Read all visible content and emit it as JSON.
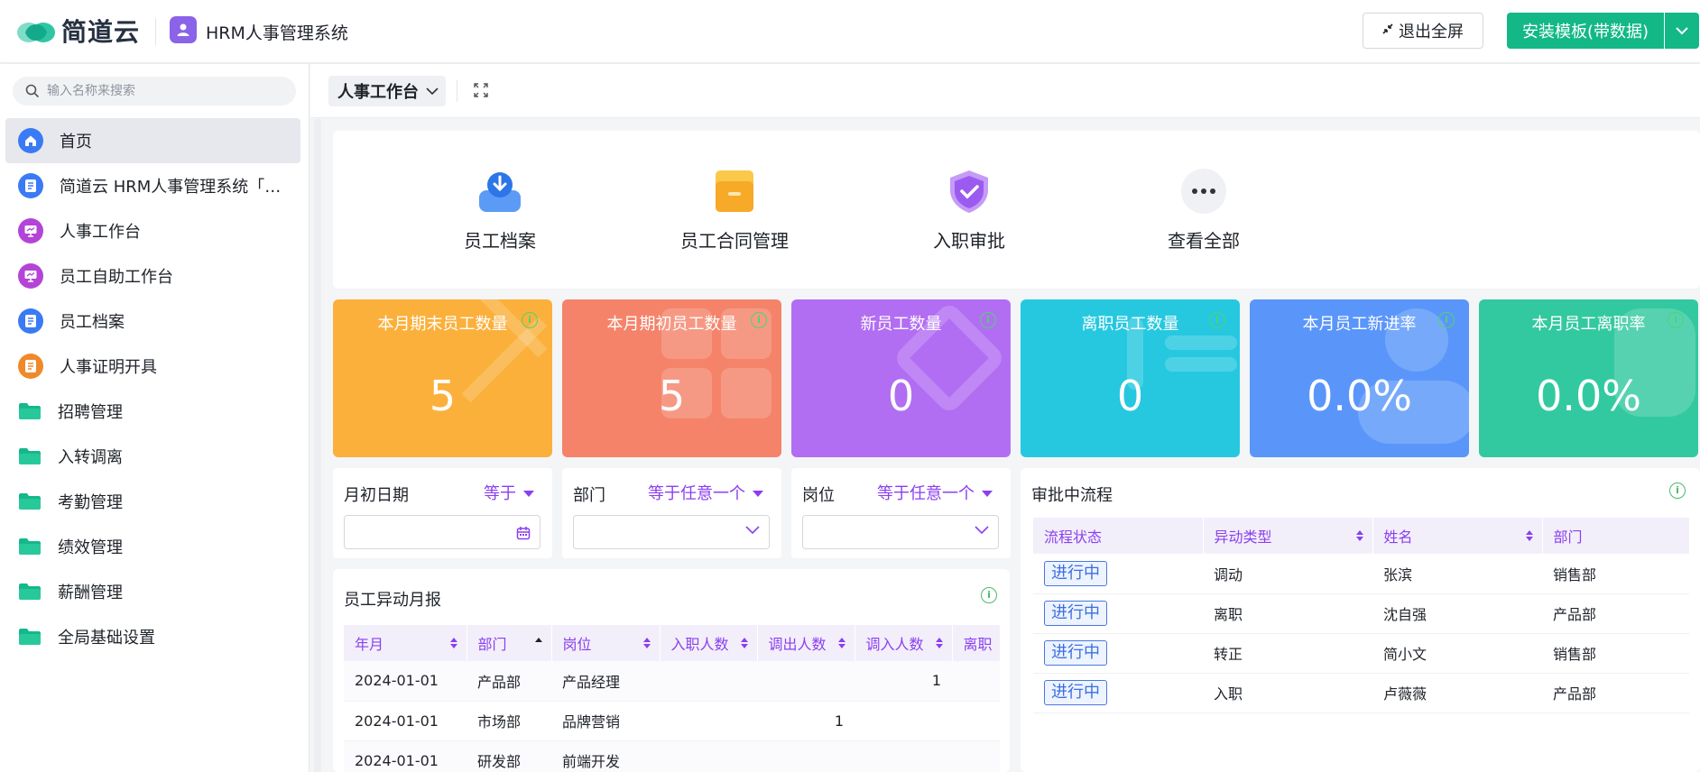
{
  "header": {
    "brand": "简道云",
    "app_title": "HRM人事管理系统",
    "exit_fullscreen": "退出全屏",
    "install_template": "安装模板(带数据)",
    "accent": "#13b886"
  },
  "sidebar": {
    "search_placeholder": "输入名称来搜索",
    "items": [
      {
        "label": "首页",
        "icon": "home-icon",
        "color": "#3a7bf5"
      },
      {
        "label": "简道云 HRM人事管理系统「必读」",
        "icon": "document-icon",
        "color": "#3a7bf5"
      },
      {
        "label": "人事工作台",
        "icon": "dashboard-icon",
        "color": "#b444d8"
      },
      {
        "label": "员工自助工作台",
        "icon": "dashboard-icon",
        "color": "#b444d8"
      },
      {
        "label": "员工档案",
        "icon": "document-icon",
        "color": "#3a7bf5"
      },
      {
        "label": "人事证明开具",
        "icon": "document-icon",
        "color": "#f0892a"
      },
      {
        "label": "招聘管理",
        "icon": "folder-icon",
        "color": "#14b88a"
      },
      {
        "label": "入转调离",
        "icon": "folder-icon",
        "color": "#14b88a"
      },
      {
        "label": "考勤管理",
        "icon": "folder-icon",
        "color": "#14b88a"
      },
      {
        "label": "绩效管理",
        "icon": "folder-icon",
        "color": "#14b88a"
      },
      {
        "label": "薪酬管理",
        "icon": "folder-icon",
        "color": "#14b88a"
      },
      {
        "label": "全局基础设置",
        "icon": "folder-icon",
        "color": "#14b88a"
      }
    ]
  },
  "tabbar": {
    "current": "人事工作台"
  },
  "quick_links": [
    {
      "label": "员工档案",
      "icon": "employee-file-icon"
    },
    {
      "label": "员工合同管理",
      "icon": "contract-folder-icon"
    },
    {
      "label": "入职审批",
      "icon": "approval-shield-icon"
    },
    {
      "label": "查看全部",
      "icon": "more-icon"
    }
  ],
  "stats": [
    {
      "title": "本月期末员工数量",
      "value": "5",
      "color": "#fbb03b"
    },
    {
      "title": "本月期初员工数量",
      "value": "5",
      "color": "#f5836a"
    },
    {
      "title": "新员工数量",
      "value": "0",
      "color": "#b26ef2"
    },
    {
      "title": "离职员工数量",
      "value": "0",
      "color": "#26c8e0"
    },
    {
      "title": "本月员工新进率",
      "value": "0.0%",
      "color": "#5a96fa"
    },
    {
      "title": "本月员工离职率",
      "value": "0.0%",
      "color": "#33c9a0"
    }
  ],
  "filters": [
    {
      "label": "月初日期",
      "op": "等于",
      "type": "date"
    },
    {
      "label": "部门",
      "op": "等于任意一个",
      "type": "select"
    },
    {
      "label": "岗位",
      "op": "等于任意一个",
      "type": "select"
    }
  ],
  "report": {
    "title": "员工异动月报",
    "columns": [
      "年月",
      "部门",
      "岗位",
      "入职人数",
      "调出人数",
      "调入人数",
      "离职"
    ],
    "rows": [
      [
        "2024-01-01",
        "产品部",
        "产品经理",
        "",
        "",
        "1",
        ""
      ],
      [
        "2024-01-01",
        "市场部",
        "品牌营销",
        "",
        "1",
        "",
        ""
      ],
      [
        "2024-01-01",
        "研发部",
        "前端开发",
        "",
        "",
        "",
        ""
      ]
    ]
  },
  "approvals": {
    "title": "审批中流程",
    "columns": [
      "流程状态",
      "异动类型",
      "姓名",
      "部门"
    ],
    "rows": [
      [
        "进行中",
        "调动",
        "张滨",
        "销售部"
      ],
      [
        "进行中",
        "离职",
        "沈自强",
        "产品部"
      ],
      [
        "进行中",
        "转正",
        "简小文",
        "销售部"
      ],
      [
        "进行中",
        "入职",
        "卢薇薇",
        "产品部"
      ]
    ]
  }
}
